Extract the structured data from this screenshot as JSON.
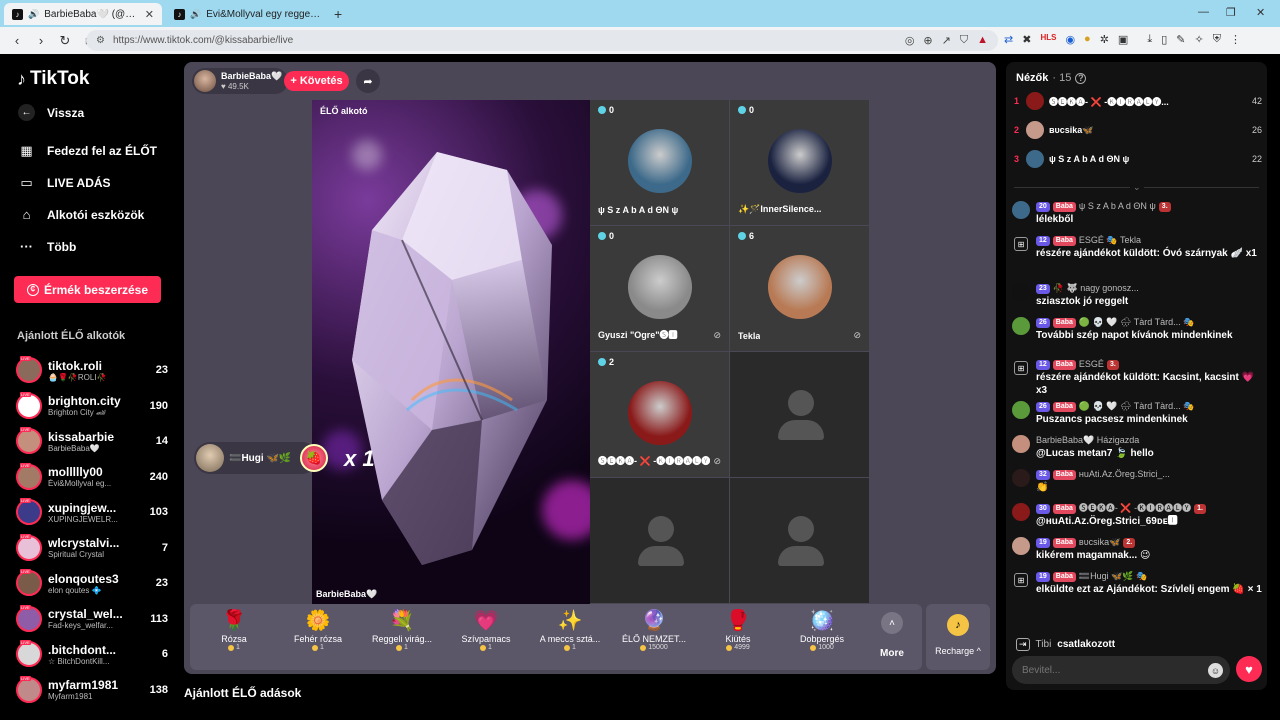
{
  "browser": {
    "tabs": [
      {
        "title": "BarbieBaba🤍 (@kissabarbie",
        "active": true
      },
      {
        "title": "Évi&Mollyval egy reggeli ☕😍",
        "active": false
      }
    ],
    "url": "https://www.tiktok.com/@kissabarbie/live"
  },
  "sidebar": {
    "logo": "TikTok",
    "back": "Vissza",
    "nav": [
      {
        "label": "Fedezd fel az ÉLŐT",
        "icon": "calendar-icon"
      },
      {
        "label": "LIVE ADÁS",
        "icon": "camera-icon"
      },
      {
        "label": "Alkotói eszközök",
        "icon": "house-icon"
      },
      {
        "label": "Több",
        "icon": "more-icon"
      }
    ],
    "coins_button": "Érmék beszerzése",
    "recommended_title": "Ajánlott ÉLŐ alkotók",
    "creators": [
      {
        "name": "tiktok.roli",
        "sub": "🧁🌹🥀ROLI🥀",
        "count": "23",
        "color": "#8a6a5a"
      },
      {
        "name": "brighton.city",
        "sub": "Brighton City 🏎",
        "count": "190",
        "color": "#ffffff"
      },
      {
        "name": "kissabarbie",
        "sub": "BarbieBaba🤍",
        "count": "14",
        "color": "#c58f7d"
      },
      {
        "name": "mollllly00",
        "sub": "Évi&Mollyval eg...",
        "count": "240",
        "color": "#a37a66"
      },
      {
        "name": "xupingjew...",
        "sub": "XUPINGJEWELR...",
        "count": "103",
        "color": "#3b3b8a"
      },
      {
        "name": "wlcrystalvi...",
        "sub": "Spiritual Crystal",
        "count": "7",
        "color": "#e8c1d8"
      },
      {
        "name": "elonqoutes3",
        "sub": "elon qoutes 💠",
        "count": "23",
        "color": "#7a5a48"
      },
      {
        "name": "crystal_wel...",
        "sub": "Fad-keys_welfar...",
        "count": "113",
        "color": "#8f5ca8"
      },
      {
        "name": ".bitchdont...",
        "sub": "☆ BitchDontKill...",
        "count": "6",
        "color": "#d8d8d8"
      },
      {
        "name": "myfarm1981",
        "sub": "Myfarm1981",
        "count": "138",
        "color": "#c08a8a"
      }
    ]
  },
  "stage": {
    "host_name": "BarbieBaba🤍",
    "host_likes": "♥ 49.5K",
    "follow": "+ Követés",
    "main_label": "ÉLŐ alkotó",
    "main_footer": "BarbieBaba🤍",
    "tiles": [
      {
        "count": "0",
        "name": "ψ S z A b A d ΘN ψ",
        "avatar": "#3d6a8a",
        "muted": false,
        "empty": false
      },
      {
        "count": "0",
        "name": "✨🪄InnerSilence...",
        "avatar": "#1a2240",
        "muted": false,
        "empty": false
      },
      {
        "count": "0",
        "name": "Gyuszi \"Ogre\"🅢🅸",
        "avatar": "#8a8a8a",
        "muted": true,
        "empty": false
      },
      {
        "count": "6",
        "name": "Tekla",
        "avatar": "#b87a55",
        "muted": true,
        "empty": false
      },
      {
        "count": "2",
        "name": "🅢🅔🅚🅐- ❌ -🅚🅘🅡🅐🅛🅨",
        "avatar": "#8a1a1a",
        "muted": true,
        "empty": false
      },
      {
        "count": "",
        "name": "",
        "avatar": "",
        "muted": false,
        "empty": true
      },
      {
        "count": "",
        "name": "",
        "avatar": "",
        "muted": false,
        "empty": true
      },
      {
        "count": "",
        "name": "",
        "avatar": "",
        "muted": false,
        "empty": true
      }
    ],
    "gift_popup": {
      "name": "🟰Hugi 🦋🌿",
      "multiplier": "x 1"
    },
    "gifts": [
      {
        "icon": "🌹",
        "name": "Rózsa",
        "price": "1"
      },
      {
        "icon": "🌼",
        "name": "Fehér rózsa",
        "price": "1"
      },
      {
        "icon": "💐",
        "name": "Reggeli virág...",
        "price": "1"
      },
      {
        "icon": "💗",
        "name": "Szívpamacs",
        "price": "1"
      },
      {
        "icon": "✨",
        "name": "A meccs sztá...",
        "price": "1"
      },
      {
        "icon": "🔮",
        "name": "ÉLŐ NEMZET...",
        "price": "15000"
      },
      {
        "icon": "🥊",
        "name": "Kiütés",
        "price": "4999"
      },
      {
        "icon": "🪩",
        "name": "Dobpergés",
        "price": "1000"
      }
    ],
    "more": "More",
    "recharge": "Recharge ^"
  },
  "recommended_live_title": "Ajánlott ÉLŐ adások",
  "chat": {
    "viewers_label": "Nézők",
    "viewers_count": "· 15",
    "top_viewers": [
      {
        "rank": "1",
        "name": "🅢🅔🅚🅐- ❌ -🅚🅘🅡🅐🅛🅨...",
        "score": "42",
        "color": "#8a1a1a"
      },
      {
        "rank": "2",
        "name": "ʙᴜcsika🦋",
        "score": "26",
        "color": "#c59a8a"
      },
      {
        "rank": "3",
        "name": "ψ S z A b A d ΘN ψ",
        "score": "22",
        "color": "#3d6a8a"
      }
    ],
    "messages": [
      {
        "type": "user",
        "lvl": "20",
        "fan": "Baba",
        "user": "ψ S z A b A d ΘN ψ",
        "rank": "3.",
        "text": "lélekből",
        "color": "#3d6a8a"
      },
      {
        "type": "gift",
        "lvl": "12",
        "fan": "Baba",
        "user": "ESGÉ 🎭 Tekla",
        "rank": "",
        "text": "részére ajándékot küldött: Óvó szárnyak 🪽 x1",
        "color": ""
      },
      {
        "type": "user",
        "lvl": "23",
        "fan": "",
        "user": "🥀 🐺 nagy gonosz...",
        "rank": "",
        "text": "sziasztok jó reggelt",
        "color": "#111"
      },
      {
        "type": "user",
        "lvl": "26",
        "fan": "Baba",
        "user": "🟢 💀 🤍 🌧 Tàrd Tàrd... 🎭",
        "rank": "",
        "text": "További szép napot kívánok mindenkinek",
        "color": "#5a9a3a"
      },
      {
        "type": "gift",
        "lvl": "12",
        "fan": "Baba",
        "user": "ESGÉ",
        "rank": "3.",
        "text": "részére ajándékot küldött: Kacsint, kacsint 💗 x3",
        "color": ""
      },
      {
        "type": "user",
        "lvl": "26",
        "fan": "Baba",
        "user": "🟢 💀 🤍 🌧 Tàrd Tàrd... 🎭",
        "rank": "",
        "text": "Puszancs pacsesz mindenkinek",
        "color": "#5a9a3a"
      },
      {
        "type": "user",
        "lvl": "",
        "fan": "",
        "user": "BarbieBaba🤍 Házigazda",
        "rank": "",
        "text": "@Lucas metan7 🍃 hello",
        "color": "#c58f7d"
      },
      {
        "type": "user",
        "lvl": "32",
        "fan": "Baba",
        "user": "ʜuAti.Az.Öreg.Strici_...",
        "rank": "",
        "text": "👏",
        "color": "#2a1a1a"
      },
      {
        "type": "user",
        "lvl": "30",
        "fan": "Baba",
        "user": "🅢🅔🅚🅐- ❌ -🅚🅘🅡🅐🅛🅨",
        "rank": "1.",
        "text": "@ʜuAti.Az.Öreg.Strici_69ᴅᴇ🅸",
        "color": "#8a1a1a"
      },
      {
        "type": "user",
        "lvl": "19",
        "fan": "Baba",
        "user": "ʙᴜcsika🦋",
        "rank": "2.",
        "text": "kikérem magamnak... 😉",
        "color": "#c59a8a"
      },
      {
        "type": "gift",
        "lvl": "19",
        "fan": "Baba",
        "user": "🟰Hugi 🦋🌿 🎭",
        "rank": "",
        "text": "elküldte ezt az Ajándékot: Szívlelj engem 🍓 × 1",
        "color": ""
      }
    ],
    "join_name": "Tibi",
    "join_text": "csatlakozott",
    "input_placeholder": "Bevitel..."
  }
}
